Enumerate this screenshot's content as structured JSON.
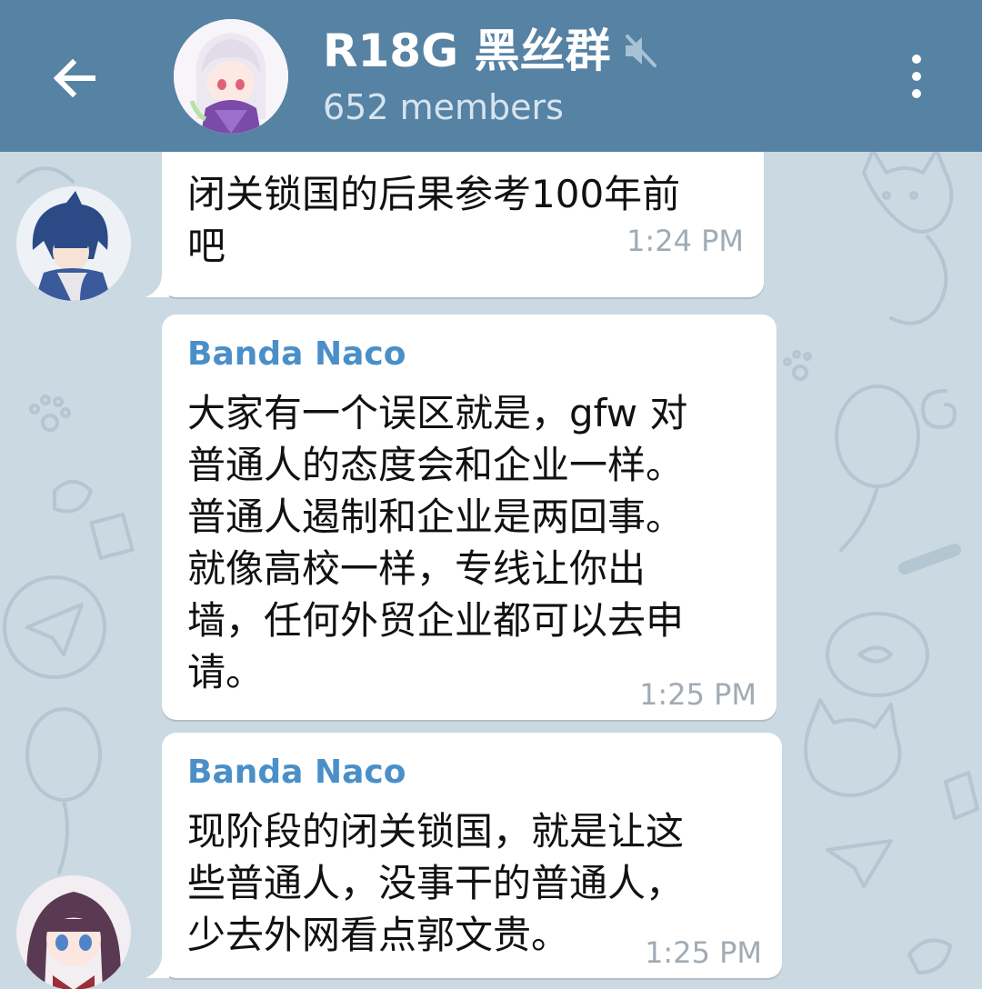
{
  "header": {
    "title": "R18G 黑丝群",
    "subtitle": "652 members",
    "color": "#5682a3",
    "icons": {
      "back": "arrow-left-icon",
      "mute": "speaker-muted-icon",
      "menu": "more-vertical-icon"
    }
  },
  "messages": [
    {
      "text": "闭关锁国的后果参考100年前\n吧",
      "time": "1:24 PM"
    },
    {
      "sender": "Banda Naco",
      "text": "大家有一个误区就是，gfw 对\n普通人的态度会和企业一样。\n普通人遏制和企业是两回事。\n就像高校一样，专线让你出\n墙，任何外贸企业都可以去申\n请。",
      "time": "1:25 PM"
    },
    {
      "sender": "Banda Naco",
      "text": "现阶段的闭关锁国，就是让这\n些普通人，没事干的普通人，\n少去外网看点郭文贵。",
      "time": "1:25 PM"
    }
  ],
  "colors": {
    "sender_name": "#4a8fc8",
    "timestamp": "#a1abb4",
    "wallpaper": "#cbd9e2"
  }
}
